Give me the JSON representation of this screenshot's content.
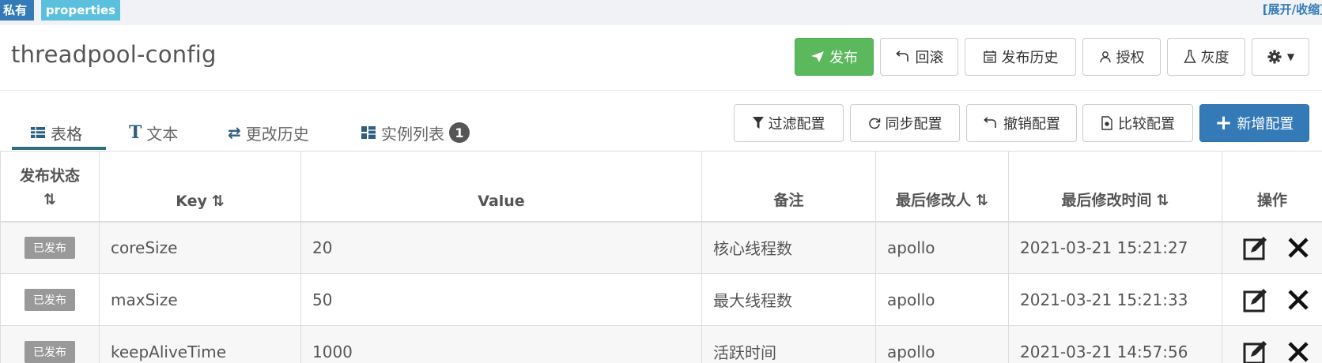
{
  "namespace": {
    "visibility_tag": "私有",
    "format_tag": "properties",
    "toggle_link": "[展开/收缩]",
    "title": "threadpool-config"
  },
  "header_buttons": {
    "publish": "发布",
    "rollback": "回滚",
    "publish_history": "发布历史",
    "authorize": "授权",
    "gray": "灰度",
    "settings_icon": "gear-icon"
  },
  "tabs": [
    {
      "label": "表格",
      "icon": "table-icon",
      "active": true
    },
    {
      "label": "文本",
      "icon": "text-icon",
      "active": false
    },
    {
      "label": "更改历史",
      "icon": "history-icon",
      "active": false
    },
    {
      "label": "实例列表",
      "icon": "instances-icon",
      "badge": "1",
      "active": false
    }
  ],
  "toolbar": {
    "filter": "过滤配置",
    "sync": "同步配置",
    "revoke": "撤销配置",
    "compare": "比较配置",
    "add": "新增配置"
  },
  "table": {
    "columns": [
      "发布状态",
      "Key",
      "Value",
      "备注",
      "最后修改人",
      "最后修改时间",
      "操作"
    ],
    "sort_icon": "⇅",
    "rows": [
      {
        "status": "已发布",
        "key": "coreSize",
        "value": "20",
        "comment": "核心线程数",
        "modifier": "apollo",
        "time": "2021-03-21 15:21:27"
      },
      {
        "status": "已发布",
        "key": "maxSize",
        "value": "50",
        "comment": "最大线程数",
        "modifier": "apollo",
        "time": "2021-03-21 15:21:33"
      },
      {
        "status": "已发布",
        "key": "keepAliveTime",
        "value": "1000",
        "comment": "活跃时间",
        "modifier": "apollo",
        "time": "2021-03-21 14:57:56"
      }
    ]
  },
  "colors": {
    "success": "#5cb85c",
    "primary": "#337ab7",
    "info": "#5bc0de",
    "tab_underline": "#2f6f7e"
  }
}
